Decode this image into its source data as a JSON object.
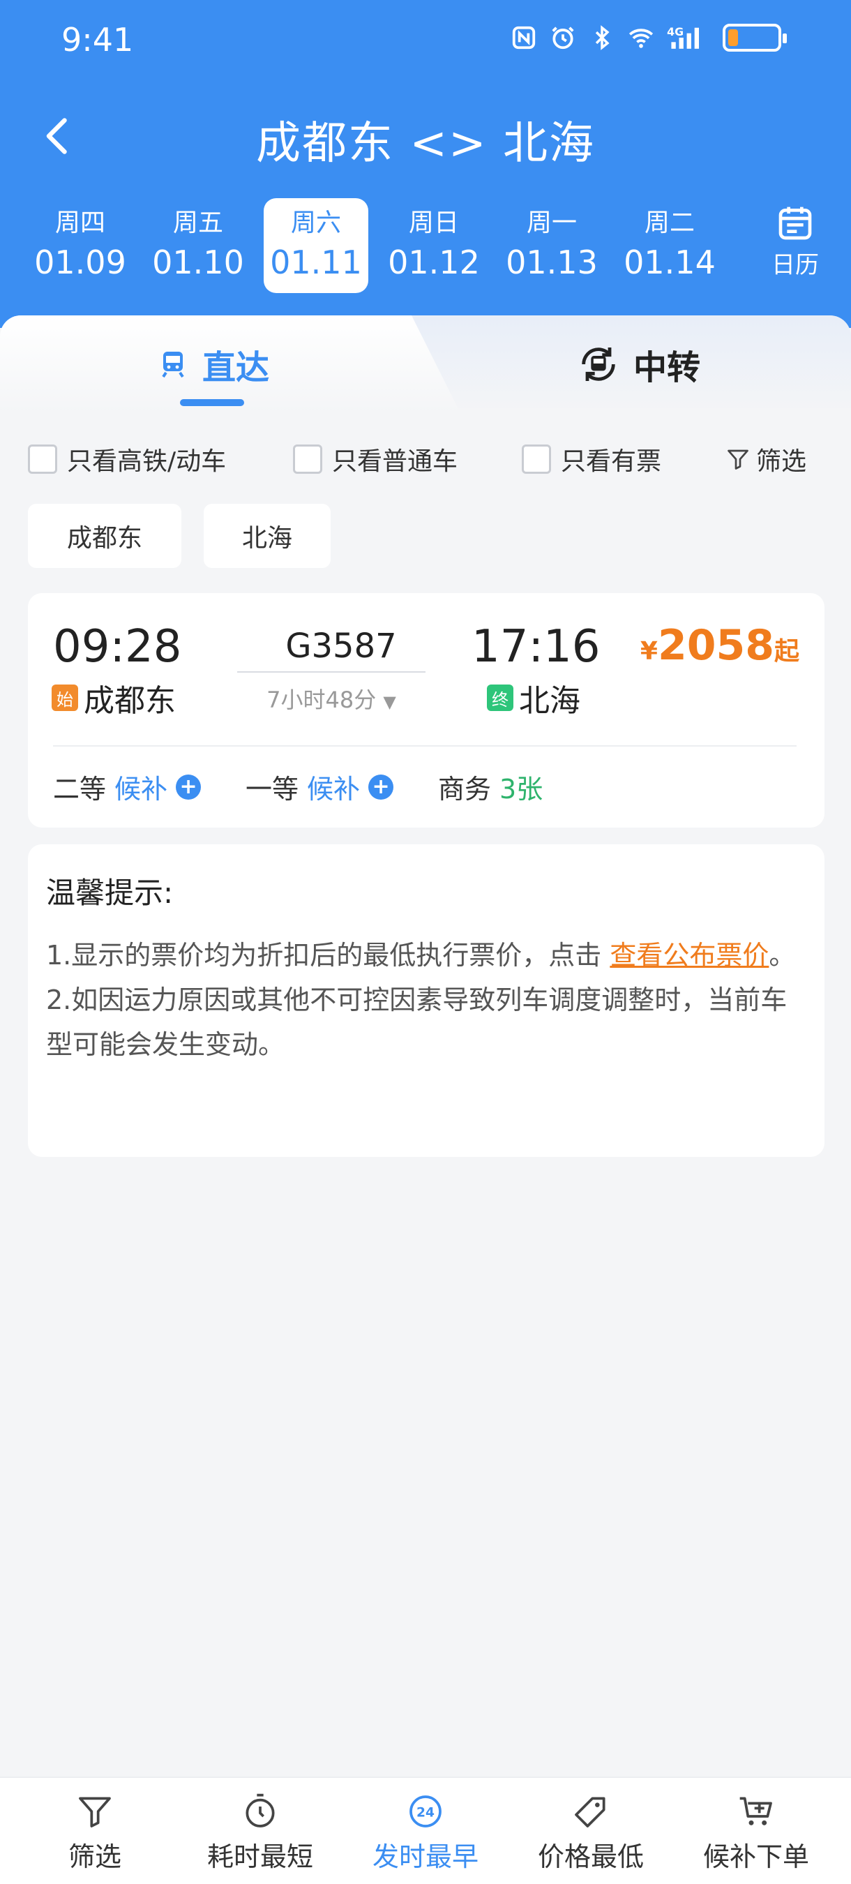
{
  "status_bar": {
    "time": "9:41",
    "network": "4G",
    "battery_level_percent": 20
  },
  "header": {
    "title": "成都东 <> 北海",
    "dates": [
      {
        "weekday": "周四",
        "date": "01.09",
        "active": false
      },
      {
        "weekday": "周五",
        "date": "01.10",
        "active": false
      },
      {
        "weekday": "周六",
        "date": "01.11",
        "active": true
      },
      {
        "weekday": "周日",
        "date": "01.12",
        "active": false
      },
      {
        "weekday": "周一",
        "date": "01.13",
        "active": false
      },
      {
        "weekday": "周二",
        "date": "01.14",
        "active": false
      }
    ],
    "calendar_label": "日历"
  },
  "tabs": {
    "direct": "直达",
    "transfer": "中转"
  },
  "filters": {
    "high_speed_only": "只看高铁/动车",
    "normal_only": "只看普通车",
    "available_only": "只看有票",
    "filter_label": "筛选"
  },
  "stations": {
    "from": "成都东",
    "to": "北海"
  },
  "train": {
    "depart_time": "09:28",
    "arrive_time": "17:16",
    "train_number": "G3587",
    "duration": "7小时48分",
    "start_tag": "始",
    "end_tag": "终",
    "from_station": "成都东",
    "to_station": "北海",
    "price_currency": "¥",
    "price": "2058",
    "price_suffix": "起",
    "seats": [
      {
        "class": "二等",
        "status": "候补"
      },
      {
        "class": "一等",
        "status": "候补"
      },
      {
        "class": "商务",
        "status": "3张"
      }
    ]
  },
  "tips": {
    "title": "温馨提示:",
    "line1_prefix": "1.显示的票价均为折扣后的最低执行票价，点击 ",
    "line1_link": "查看公布票价",
    "line1_suffix": "。",
    "line2": "2.如因运力原因或其他不可控因素导致列车调度调整时，当前车型可能会发生变动。"
  },
  "bottom_bar": {
    "filter": "筛选",
    "shortest": "耗时最短",
    "earliest": "发时最早",
    "earliest_icon_text": "24",
    "cheapest": "价格最低",
    "waitlist": "候补下单"
  },
  "colors": {
    "brand": "#3b8ef2",
    "price": "#f07c1d",
    "available": "#2eb36c"
  }
}
